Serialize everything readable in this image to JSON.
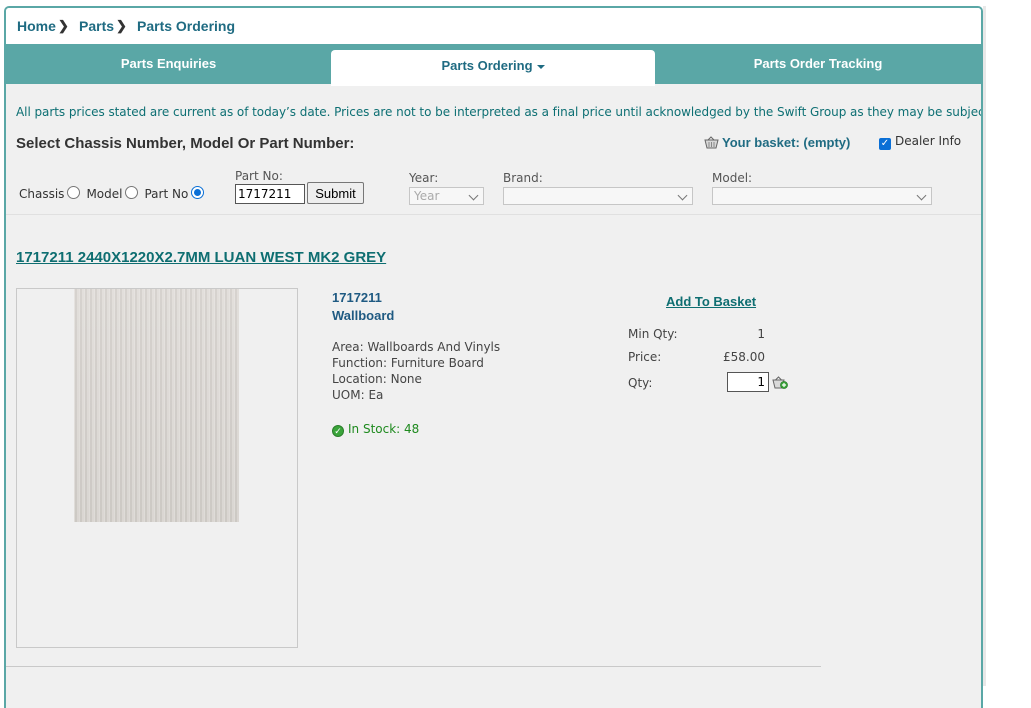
{
  "breadcrumb": {
    "home": "Home",
    "parts": "Parts",
    "current": "Parts Ordering"
  },
  "tabs": [
    {
      "label": "Parts Enquiries",
      "active": false
    },
    {
      "label": "Parts Ordering",
      "active": true
    },
    {
      "label": "Parts Order Tracking",
      "active": false
    }
  ],
  "notice": "All parts prices stated are current as of today’s date. Prices are not to be interpreted as a final price until acknowledged by the Swift Group as they may be subject to change.",
  "search": {
    "title": "Select Chassis Number, Model Or Part Number:",
    "basket": "Your basket: (empty)",
    "dealer_info": "Dealer Info",
    "dealer_info_checked": true,
    "radio_chassis": "Chassis",
    "radio_model": "Model",
    "radio_partno": "Part No",
    "selected_radio": "Part No",
    "partno_label": "Part No:",
    "partno_value": "1717211",
    "submit_label": "Submit",
    "year_label": "Year:",
    "year_value": "Year",
    "brand_label": "Brand:",
    "brand_value": "",
    "model_label": "Model:",
    "model_value": ""
  },
  "product": {
    "title": "1717211 2440X1220X2.7MM LUAN WEST MK2 GREY",
    "code": "1717211",
    "name": "Wallboard",
    "area": "Area: Wallboards And Vinyls",
    "function": "Function: Furniture Board",
    "location": "Location: None",
    "uom": "UOM: Ea",
    "stock": "In Stock: 48",
    "add_to_basket": "Add To Basket",
    "min_qty_label": "Min Qty:",
    "min_qty_value": "1",
    "price_label": "Price:",
    "price_value": "£58.00",
    "qty_label": "Qty:",
    "qty_value": "1"
  },
  "colors": {
    "accent": "#5aa7a6",
    "link": "#1f6b82",
    "stock": "#1e8a1e"
  }
}
